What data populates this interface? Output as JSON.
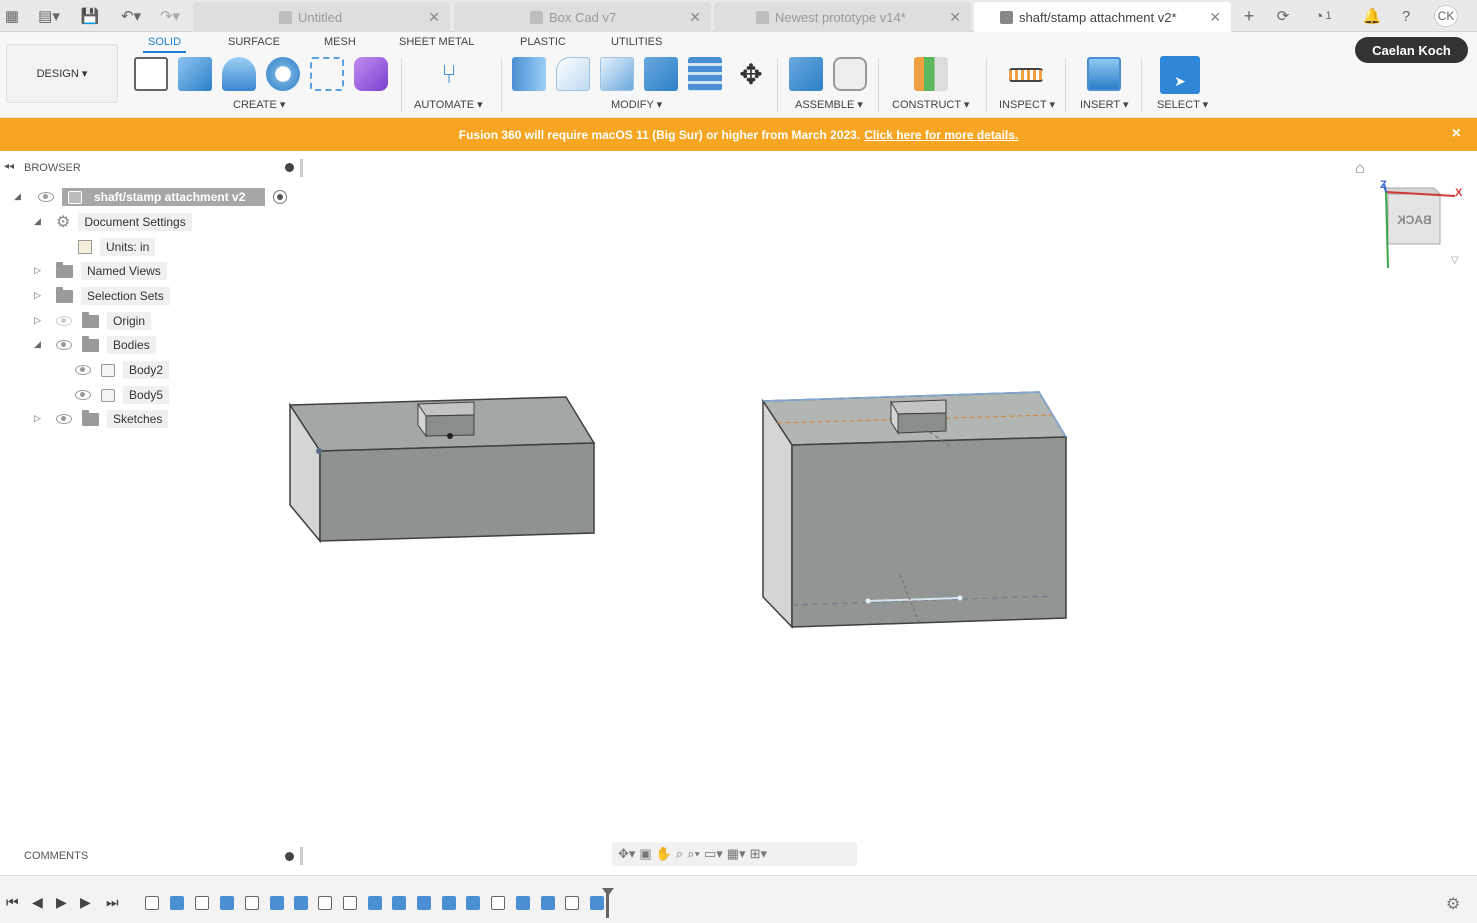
{
  "tabbar": {
    "tabs": [
      {
        "label": "Untitled"
      },
      {
        "label": "Box Cad v7"
      },
      {
        "label": "Newest prototype v14*"
      },
      {
        "label": "shaft/stamp attachment v2*"
      }
    ],
    "job_count": "1",
    "avatar_initials": "CK"
  },
  "toolbar": {
    "workspace": "DESIGN ▾",
    "tabs": [
      "SOLID",
      "SURFACE",
      "MESH",
      "SHEET METAL",
      "PLASTIC",
      "UTILITIES"
    ],
    "groups": [
      "CREATE ▾",
      "AUTOMATE ▾",
      "MODIFY ▾",
      "ASSEMBLE ▾",
      "CONSTRUCT ▾",
      "INSPECT ▾",
      "INSERT ▾",
      "SELECT ▾"
    ],
    "accent": "#1c7fd3"
  },
  "user": {
    "name": "Caelan Koch"
  },
  "banner": {
    "text": "Fusion 360 will require macOS 11 (Big Sur) or higher from March 2023.",
    "link": "Click here for more details.",
    "close": "×",
    "color": "#f6a623"
  },
  "browser": {
    "title": "BROWSER",
    "root": "shaft/stamp attachment v2",
    "items": {
      "doc_settings": "Document Settings",
      "units": "Units: in",
      "named_views": "Named Views",
      "selection_sets": "Selection Sets",
      "origin": "Origin",
      "bodies": "Bodies",
      "body2": "Body2",
      "body5": "Body5",
      "sketches": "Sketches"
    }
  },
  "viewcube": {
    "face": "BACK",
    "x_label": "X",
    "z_label": "Z"
  },
  "comments": {
    "title": "COMMENTS"
  }
}
